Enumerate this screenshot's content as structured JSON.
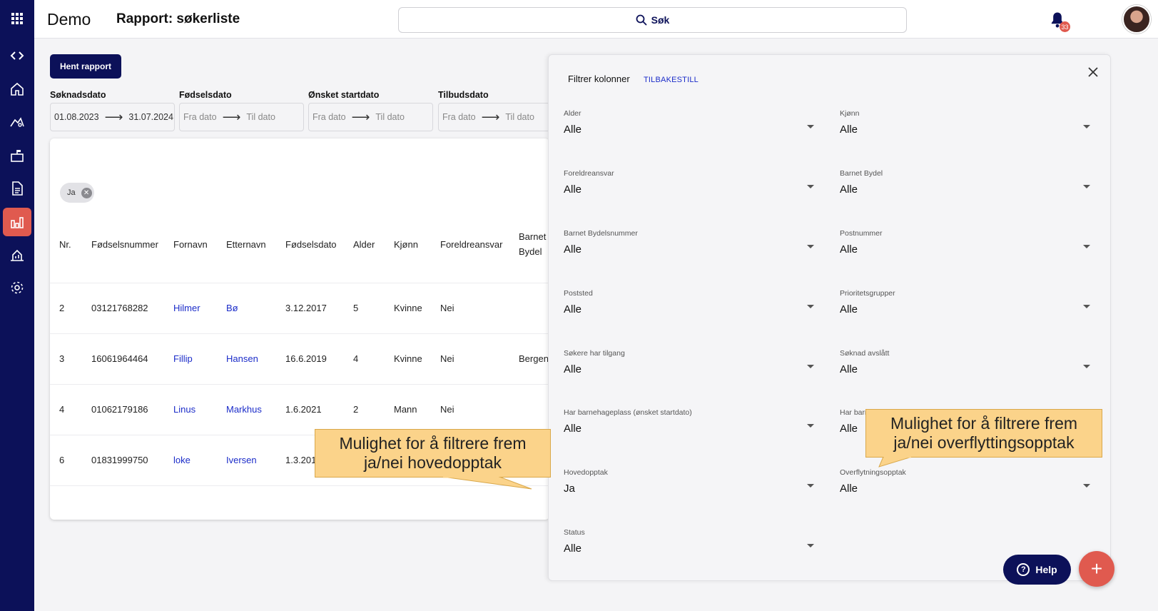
{
  "app": {
    "brand": "Demo",
    "title": "Rapport: søkerliste"
  },
  "search": {
    "label": "Søk"
  },
  "notifications": {
    "count": "33"
  },
  "sidebar": {
    "items": [
      {
        "name": "apps-grid-icon"
      },
      {
        "name": "code-icon"
      },
      {
        "name": "home-icon"
      },
      {
        "name": "playground-icon"
      },
      {
        "name": "building-icon"
      },
      {
        "name": "document-icon"
      },
      {
        "name": "report-chart-icon",
        "active": true
      },
      {
        "name": "house-chart-icon"
      },
      {
        "name": "settings-icon"
      }
    ],
    "active_color": "#e05a4f",
    "background": "#0c1159"
  },
  "toolbar": {
    "fetch_label": "Hent rapport"
  },
  "date_filters": [
    {
      "label": "Søknadsdato",
      "from": "01.08.2023",
      "to": "31.07.2024",
      "filled": true
    },
    {
      "label": "Fødselsdato",
      "from": "Fra dato",
      "to": "Til dato",
      "filled": false
    },
    {
      "label": "Ønsket startdato",
      "from": "Fra dato",
      "to": "Til dato",
      "filled": false
    },
    {
      "label": "Tilbudsdato",
      "from": "Fra dato",
      "to": "Til dato",
      "filled": false
    }
  ],
  "chip": {
    "label": "Ja"
  },
  "table": {
    "headers": [
      "Nr.",
      "Fødselsnummer",
      "Fornavn",
      "Etternavn",
      "Fødselsdato",
      "Alder",
      "Kjønn",
      "Foreldreansvar",
      "Barnet Bydel"
    ],
    "rows": [
      [
        "2",
        "03121768282",
        "Hilmer",
        "Bø",
        "3.12.2017",
        "5",
        "Kvinne",
        "Nei",
        ""
      ],
      [
        "3",
        "16061964464",
        "Fillip",
        "Hansen",
        "16.6.2019",
        "4",
        "Kvinne",
        "Nei",
        "Bergen"
      ],
      [
        "4",
        "01062179186",
        "Linus",
        "Markhus",
        "1.6.2021",
        "2",
        "Mann",
        "Nei",
        ""
      ],
      [
        "6",
        "01831999750",
        "loke",
        "Iversen",
        "1.3.2019",
        "",
        "",
        "",
        ""
      ]
    ]
  },
  "filter_panel": {
    "title": "Filtrer kolonner",
    "reset": "TILBAKESTILL",
    "fields": [
      {
        "label": "Alder",
        "value": "Alle"
      },
      {
        "label": "Kjønn",
        "value": "Alle"
      },
      {
        "label": "Foreldreansvar",
        "value": "Alle"
      },
      {
        "label": "Barnet Bydel",
        "value": "Alle"
      },
      {
        "label": "Barnet Bydelsnummer",
        "value": "Alle"
      },
      {
        "label": "Postnummer",
        "value": "Alle"
      },
      {
        "label": "Poststed",
        "value": "Alle"
      },
      {
        "label": "Prioritetsgrupper",
        "value": "Alle"
      },
      {
        "label": "Søkere har tilgang",
        "value": "Alle"
      },
      {
        "label": "Søknad avslått",
        "value": "Alle"
      },
      {
        "label": "Har barnehageplass (ønsket startdato)",
        "value": "Alle"
      },
      {
        "label": "Har barn",
        "value": "Alle"
      },
      {
        "label": "Hovedopptak",
        "value": "Ja"
      },
      {
        "label": "Overflytningsopptak",
        "value": "Alle"
      },
      {
        "label": "Status",
        "value": "Alle"
      }
    ]
  },
  "callouts": {
    "left": {
      "line1": "Mulighet for å filtrere frem",
      "line2": "ja/nei hovedopptak"
    },
    "right": {
      "line1": "Mulighet for å filtrere frem",
      "line2": "ja/nei overflyttingsopptak"
    }
  },
  "help": {
    "label": "Help"
  }
}
